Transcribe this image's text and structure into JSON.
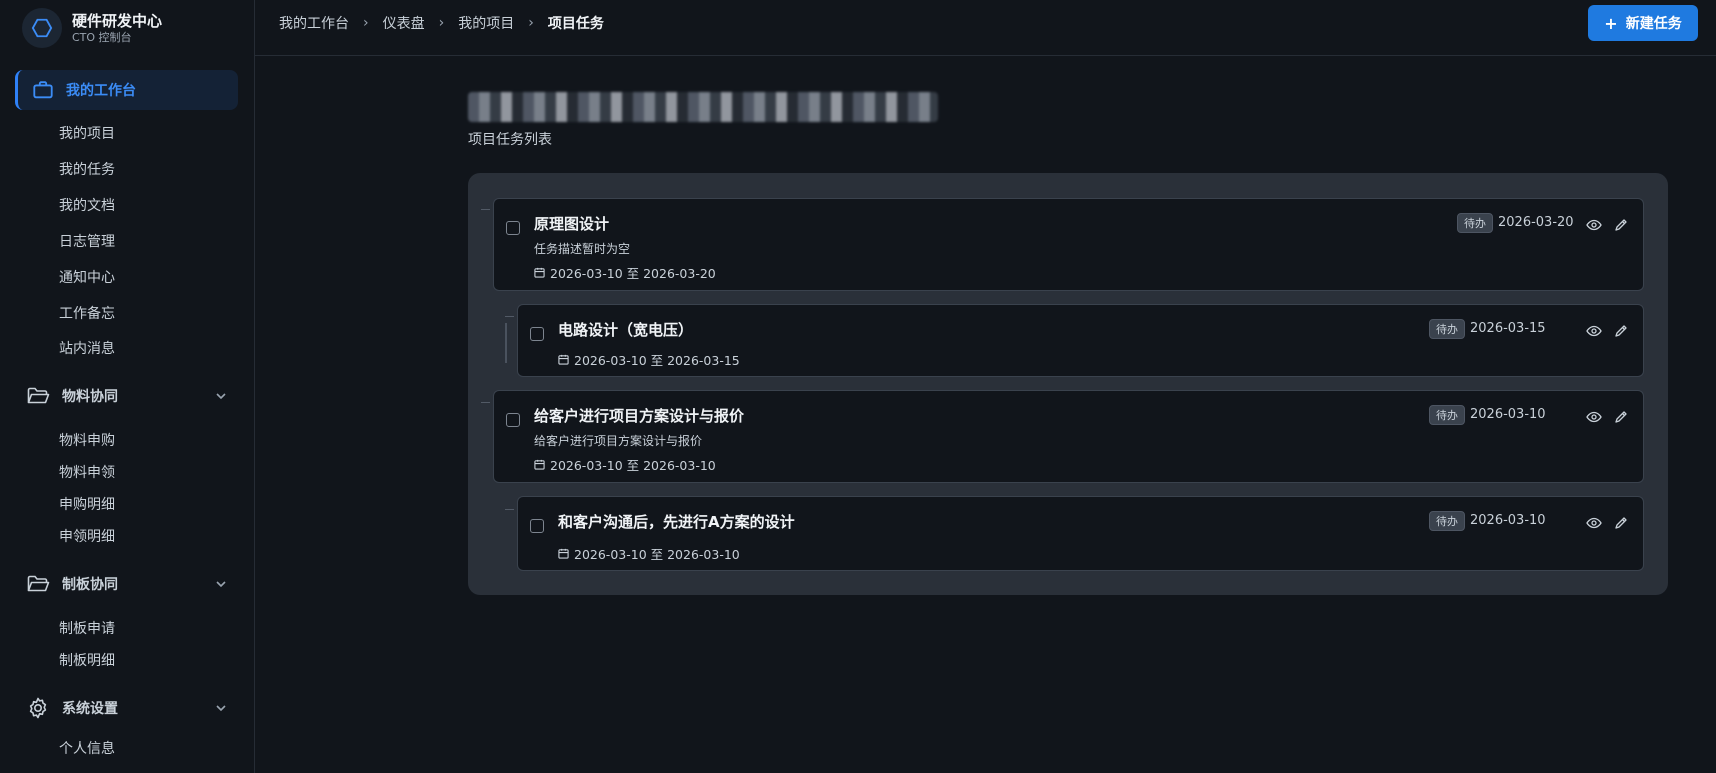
{
  "brand": {
    "title": "硬件研发中心",
    "subtitle": "CTO 控制台"
  },
  "sidebar": {
    "active": "我的工作台",
    "workspace_items": [
      "我的项目",
      "我的任务",
      "我的文档",
      "日志管理",
      "通知中心",
      "工作备忘",
      "站内消息"
    ],
    "groups": [
      {
        "label": "物料协同",
        "icon": "folder-open-icon",
        "items": [
          "物料申购",
          "物料申领",
          "申购明细",
          "申领明细"
        ]
      },
      {
        "label": "制板协同",
        "icon": "folder-open-icon",
        "items": [
          "制板申请",
          "制板明细"
        ]
      },
      {
        "label": "系统设置",
        "icon": "gear-icon",
        "items": [
          "个人信息"
        ]
      }
    ]
  },
  "header": {
    "breadcrumb": [
      "我的工作台",
      "仪表盘",
      "我的项目",
      "项目任务"
    ],
    "new_button": "新建任务",
    "new_button_icon": "plus-icon"
  },
  "page": {
    "title": "",
    "subtitle": "项目任务列表"
  },
  "tasks": [
    {
      "title": "原理图设计",
      "description": "任务描述暂时为空",
      "range": "2026-03-10 至 2026-03-20",
      "status": "待办",
      "due": "2026-03-20",
      "level": 0
    },
    {
      "title": "电路设计（宽电压）",
      "description": "",
      "range": "2026-03-10 至 2026-03-15",
      "status": "待办",
      "due": "2026-03-15",
      "level": 1
    },
    {
      "title": "给客户进行项目方案设计与报价",
      "description": "给客户进行项目方案设计与报价",
      "range": "2026-03-10 至 2026-03-10",
      "status": "待办",
      "due": "2026-03-10",
      "level": 0
    },
    {
      "title": "和客户沟通后，先进行A方案的设计",
      "description": "",
      "range": "2026-03-10 至 2026-03-10",
      "status": "待办",
      "due": "2026-03-10",
      "level": 1
    }
  ],
  "colors": {
    "accent": "#1f7ae0",
    "background": "#11151b",
    "panel": "#2a3039",
    "active_text": "#3b8cf6"
  }
}
